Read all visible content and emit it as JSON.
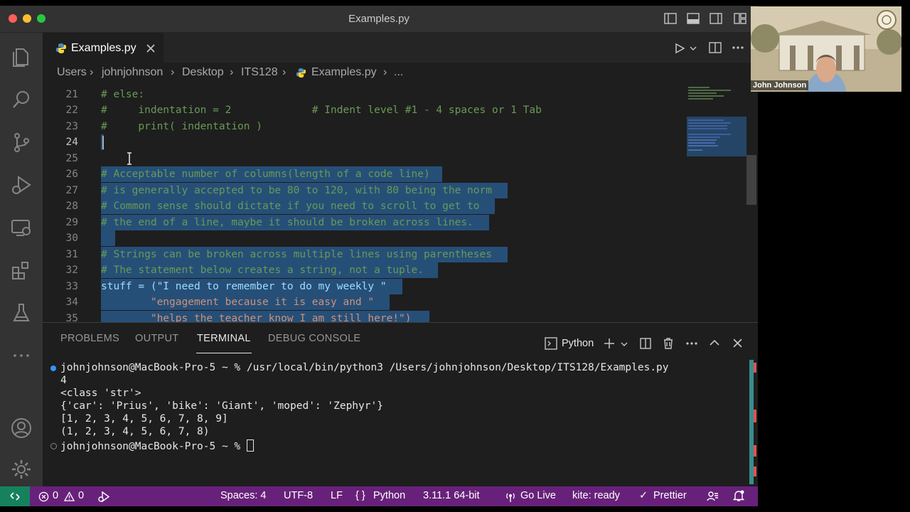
{
  "window": {
    "title": "Examples.py"
  },
  "tab": {
    "label": "Examples.py"
  },
  "breadcrumb": {
    "parts": [
      "Users",
      "johnjohnson",
      "Desktop",
      "ITS128",
      "Examples.py",
      "..."
    ]
  },
  "editor": {
    "lines": [
      {
        "num": "21",
        "text": "# else:"
      },
      {
        "num": "22",
        "text": "#     indentation = 2             # Indent level #1 - 4 spaces or 1 Tab"
      },
      {
        "num": "23",
        "text": "#     print( indentation )"
      },
      {
        "num": "24",
        "text": ""
      },
      {
        "num": "25",
        "text": ""
      },
      {
        "num": "26",
        "text": "# Acceptable number of columns(length of a code line)"
      },
      {
        "num": "27",
        "text": "# is generally accepted to be 80 to 120, with 80 being the norm"
      },
      {
        "num": "28",
        "text": "# Common sense should dictate if you need to scroll to get to"
      },
      {
        "num": "29",
        "text": "# the end of a line, maybe it should be broken across lines."
      },
      {
        "num": "30",
        "text": ""
      },
      {
        "num": "31",
        "text": "# Strings can be broken across multiple lines using parentheses"
      },
      {
        "num": "32",
        "text": "# The statement below creates a string, not a tuple."
      },
      {
        "num": "33",
        "text": "stuff = (\"I need to remember to do my weekly \""
      },
      {
        "num": "34",
        "text": "        \"engagement because it is easy and \""
      },
      {
        "num": "35",
        "text": "        \"helps the teacher know I am still here!\")"
      }
    ]
  },
  "panel": {
    "tabs": [
      "PROBLEMS",
      "OUTPUT",
      "TERMINAL",
      "DEBUG CONSOLE"
    ],
    "shell_label": "Python",
    "terminal_lines": [
      "johnjohnson@MacBook-Pro-5 ~ % /usr/local/bin/python3 /Users/johnjohnson/Desktop/ITS128/Examples.py",
      "4",
      "<class 'str'>",
      "{'car': 'Prius', 'bike': 'Giant', 'moped': 'Zephyr'}",
      "[1, 2, 3, 4, 5, 6, 7, 8, 9]",
      "(1, 2, 3, 4, 5, 6, 7, 8)",
      "johnjohnson@MacBook-Pro-5 ~ % "
    ]
  },
  "statusbar": {
    "errors": "0",
    "warnings": "0",
    "spaces": "Spaces: 4",
    "encoding": "UTF-8",
    "eol": "LF",
    "language": "Python",
    "interpreter": "3.11.1 64-bit",
    "golive": "Go Live",
    "kite": "kite: ready",
    "prettier": "Prettier"
  },
  "webcam": {
    "name": "John Johnson"
  },
  "colors": {
    "statusbar": "#68217a",
    "selection": "#264f78",
    "comment": "#6a9955",
    "remote": "#16825d"
  }
}
